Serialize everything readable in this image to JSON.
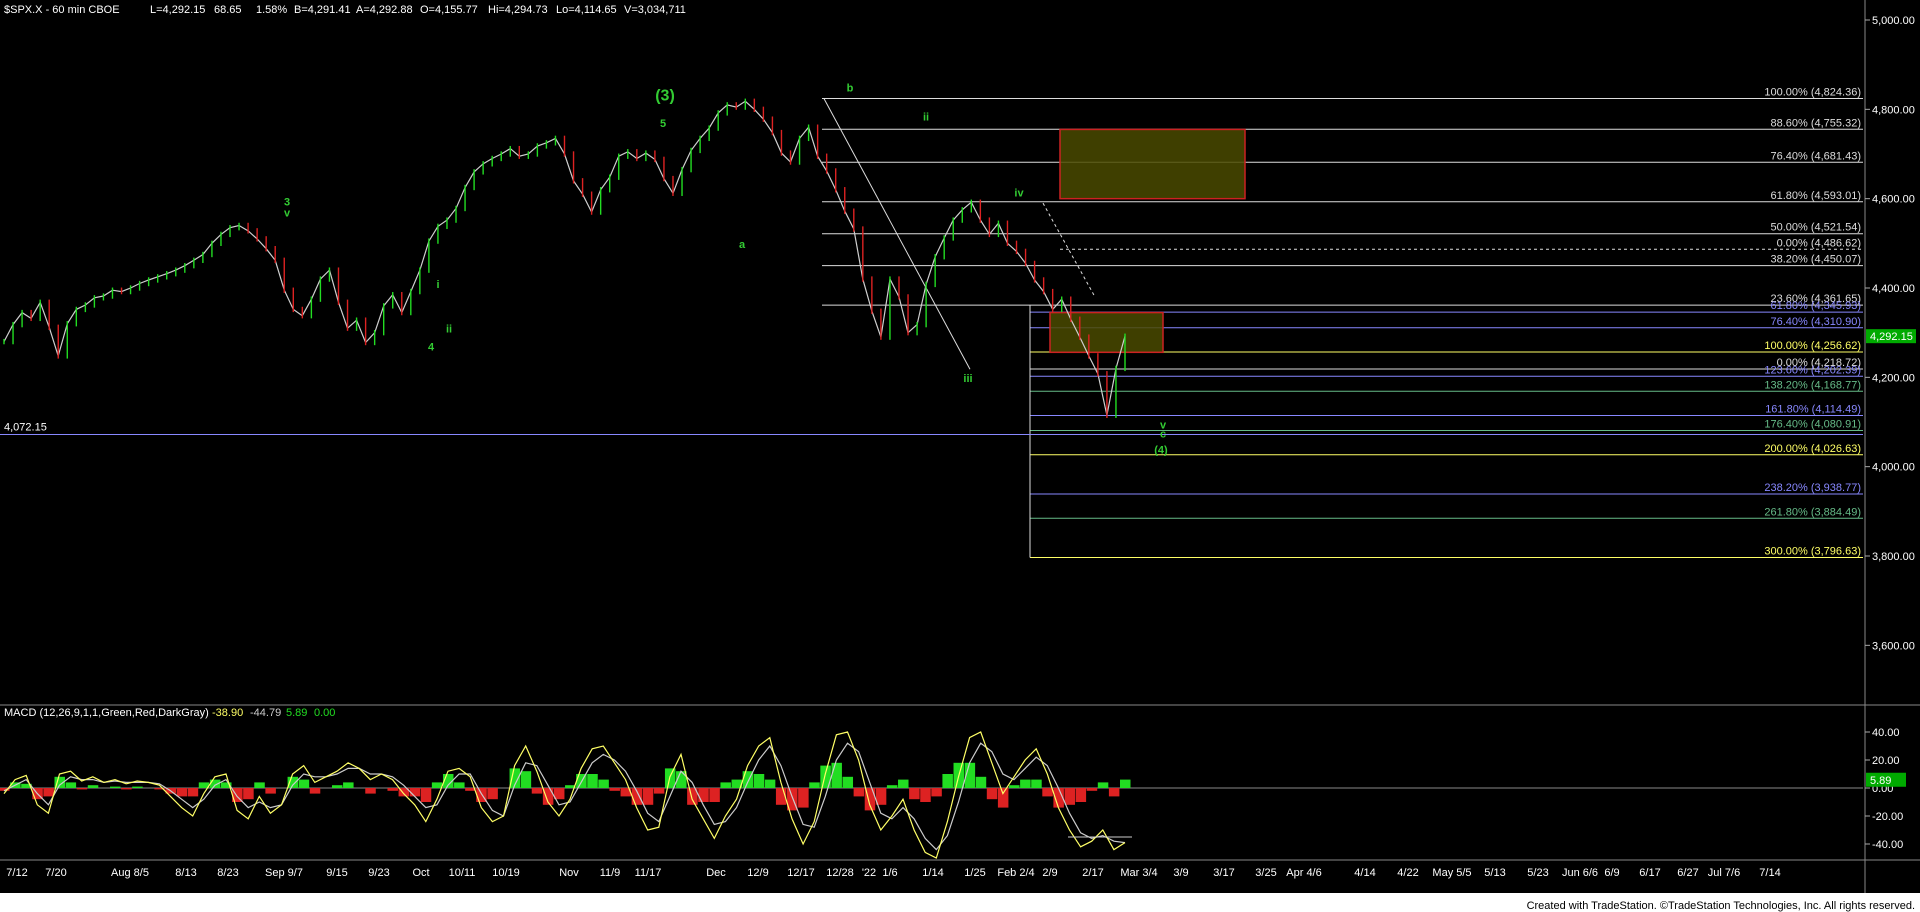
{
  "header": {
    "symbol": "$SPX.X - 60 min  CBOE",
    "last": "L=4,292.15",
    "change": "68.65",
    "change_pct": "1.58%",
    "bid": "B=4,291.41",
    "ask": "A=4,292.88",
    "open": "O=4,155.77",
    "high": "Hi=4,294.73",
    "low": "Lo=4,114.65",
    "volume": "V=3,034,711"
  },
  "footer": {
    "credit": "Created with TradeStation. ©TradeStation Technologies, Inc. All rights reserved."
  },
  "colors": {
    "background": "#000000",
    "up": "#22dd22",
    "down": "#dd2222",
    "wave_label": "#33cc33",
    "fib_yellow": "#ffff66",
    "fib_blue": "#8888ff",
    "fib_green": "#66bb88",
    "fib_white": "#dddddd",
    "macd_line": "#ffff66",
    "signal_line": "#cccccc",
    "last_price_tag": "#00aa00"
  },
  "chart_data": [
    {
      "type": "line",
      "title": "$SPX.X - 60 min",
      "ylim": [
        3500,
        5000
      ],
      "y_ticks": [
        "5,000.00",
        "4,800.00",
        "4,600.00",
        "4,400.00",
        "4,200.00",
        "4,000.00",
        "3,800.00",
        "3,600.00"
      ],
      "y_tick_values": [
        5000,
        4800,
        4600,
        4400,
        4200,
        4000,
        3800,
        3600
      ],
      "last_price_label": "4,292.15",
      "last_price": 4292.15,
      "x_ticks": [
        "7/12",
        "7/20",
        "Aug 8/5",
        "8/13",
        "8/23",
        "Sep 9/7",
        "9/15",
        "9/23",
        "Oct",
        "10/11",
        "10/19",
        "Nov",
        "11/9",
        "11/17",
        "Dec",
        "12/9",
        "12/17",
        "12/28",
        "'22",
        "1/6",
        "1/14",
        "1/25",
        "Feb 2/4",
        "2/9",
        "2/17",
        "Mar 3/4",
        "3/9",
        "3/17",
        "3/25",
        "Apr 4/6",
        "4/14",
        "4/22",
        "May 5/5",
        "5/13",
        "5/23",
        "Jun 6/6",
        "6/9",
        "6/17",
        "6/27",
        "Jul 7/6",
        "7/14"
      ],
      "series": [
        {
          "values": [
            4280,
            4318,
            4345,
            4332,
            4368,
            4312,
            4248,
            4320,
            4352,
            4362,
            4378,
            4382,
            4395,
            4392,
            4400,
            4410,
            4418,
            4425,
            4432,
            4440,
            4450,
            4462,
            4475,
            4500,
            4520,
            4535,
            4540,
            4528,
            4510,
            4488,
            4462,
            4395,
            4352,
            4338,
            4375,
            4420,
            4440,
            4368,
            4310,
            4328,
            4278,
            4300,
            4360,
            4385,
            4345,
            4392,
            4440,
            4505,
            4538,
            4552,
            4578,
            4625,
            4660,
            4678,
            4690,
            4700,
            4712,
            4695,
            4700,
            4718,
            4725,
            4735,
            4700,
            4640,
            4610,
            4570,
            4620,
            4648,
            4695,
            4705,
            4690,
            4702,
            4688,
            4645,
            4612,
            4665,
            4708,
            4735,
            4758,
            4792,
            4810,
            4805,
            4818,
            4800,
            4778,
            4748,
            4702,
            4682,
            4735,
            4760,
            4695,
            4662,
            4620,
            4572,
            4532,
            4420,
            4348,
            4290,
            4420,
            4380,
            4300,
            4318,
            4408,
            4470,
            4512,
            4552,
            4575,
            4592,
            4552,
            4520,
            4545,
            4500,
            4482,
            4455,
            4418,
            4392,
            4352,
            4375,
            4330,
            4290,
            4248,
            4208,
            4115,
            4220,
            4292
          ]
        }
      ]
    },
    {
      "type": "line",
      "title": "MACD (12,26,9,1,1,Green,Red,DarkGray)",
      "values_text": [
        "-38.90",
        "-44.79",
        "5.89",
        "0.00"
      ],
      "ylim": [
        -50,
        50
      ],
      "y_ticks": [
        "40.00",
        "20.00",
        "0.00",
        "-20.00",
        "-40.00"
      ],
      "y_tick_values": [
        40,
        20,
        0,
        -20,
        -40
      ],
      "last_value_label": "5.89",
      "last_value": 5.89,
      "series": [
        {
          "name": "MACD",
          "values": [
            -4,
            6,
            9,
            -12,
            -18,
            10,
            12,
            5,
            8,
            4,
            6,
            3,
            5,
            4,
            2,
            -6,
            -14,
            -20,
            -4,
            8,
            10,
            -16,
            -22,
            -6,
            -18,
            -12,
            10,
            16,
            4,
            8,
            12,
            18,
            14,
            6,
            10,
            6,
            -4,
            -12,
            -24,
            -8,
            12,
            14,
            8,
            -14,
            -24,
            -20,
            16,
            30,
            12,
            -10,
            -20,
            -8,
            14,
            28,
            30,
            18,
            6,
            -14,
            -30,
            -28,
            8,
            24,
            -8,
            -22,
            -36,
            -20,
            -8,
            16,
            30,
            36,
            4,
            -22,
            -40,
            -24,
            10,
            38,
            40,
            20,
            -12,
            -30,
            -20,
            -8,
            -30,
            -46,
            -50,
            -24,
            8,
            36,
            40,
            18,
            -4,
            8,
            20,
            28,
            10,
            -14,
            -30,
            -42,
            -38,
            -30,
            -44,
            -39
          ]
        },
        {
          "name": "Signal",
          "values": [
            -2,
            2,
            6,
            -4,
            -12,
            2,
            8,
            6,
            6,
            4,
            5,
            4,
            4,
            4,
            3,
            -2,
            -8,
            -14,
            -8,
            2,
            6,
            -6,
            -14,
            -10,
            -14,
            -12,
            2,
            10,
            8,
            8,
            10,
            14,
            14,
            10,
            10,
            8,
            2,
            -6,
            -14,
            -12,
            2,
            10,
            10,
            -4,
            -16,
            -20,
            2,
            18,
            16,
            2,
            -12,
            -10,
            4,
            18,
            24,
            20,
            12,
            -2,
            -18,
            -24,
            -6,
            12,
            4,
            -12,
            -26,
            -24,
            -14,
            4,
            20,
            30,
            16,
            -6,
            -26,
            -28,
            -6,
            20,
            32,
            26,
            4,
            -18,
            -22,
            -14,
            -22,
            -36,
            -44,
            -34,
            -10,
            18,
            32,
            26,
            10,
            6,
            14,
            22,
            16,
            0,
            -18,
            -32,
            -36,
            -34,
            -38,
            -39
          ]
        },
        {
          "name": "Histogram",
          "values": [
            -2,
            4,
            3,
            -8,
            -6,
            8,
            4,
            -1,
            2,
            0,
            1,
            -1,
            1,
            0,
            -1,
            -4,
            -6,
            -6,
            4,
            6,
            4,
            -10,
            -8,
            4,
            -4,
            0,
            8,
            6,
            -4,
            0,
            2,
            4,
            0,
            -4,
            0,
            -2,
            -6,
            -6,
            -10,
            4,
            10,
            4,
            -2,
            -10,
            -8,
            0,
            14,
            12,
            -4,
            -12,
            -8,
            2,
            10,
            10,
            6,
            -2,
            -6,
            -12,
            -12,
            -4,
            14,
            12,
            -12,
            -10,
            -10,
            4,
            6,
            12,
            10,
            6,
            -12,
            -16,
            -14,
            4,
            16,
            18,
            8,
            -6,
            -16,
            -12,
            2,
            6,
            -8,
            -10,
            -6,
            10,
            18,
            18,
            8,
            -8,
            -14,
            2,
            6,
            6,
            -6,
            -14,
            -12,
            -10,
            -2,
            4,
            -6,
            6
          ]
        }
      ]
    }
  ],
  "annotations": {
    "wave_labels": [
      {
        "text": "(3)",
        "price": 4820
      },
      {
        "text": "5",
        "price": 4760
      },
      {
        "text": "3",
        "price": 4585
      },
      {
        "text": "v",
        "price": 4560
      },
      {
        "text": "a",
        "price": 4490
      },
      {
        "text": "b",
        "price": 4840
      },
      {
        "text": "ii",
        "price": 4775
      },
      {
        "text": "iv",
        "price": 4605
      },
      {
        "text": "i",
        "price": 4400
      },
      {
        "text": "ii",
        "price": 4300
      },
      {
        "text": "4",
        "price": 4260
      },
      {
        "text": "iii",
        "price": 4190
      },
      {
        "text": "v",
        "price": 4085
      },
      {
        "text": "c",
        "price": 4065
      },
      {
        "text": "(4)",
        "price": 4030
      }
    ],
    "support_line_label": "4,072.15",
    "support_line_price": 4072.15,
    "fib_levels": [
      {
        "label": "100.00% (4,824.36)",
        "price": 4824.36,
        "color": "white"
      },
      {
        "label": "88.60% (4,755.32)",
        "price": 4755.32,
        "color": "white"
      },
      {
        "label": "76.40% (4,681.43)",
        "price": 4681.43,
        "color": "white"
      },
      {
        "label": "61.80% (4,593.01)",
        "price": 4593.01,
        "color": "white"
      },
      {
        "label": "50.00% (4,521.54)",
        "price": 4521.54,
        "color": "white"
      },
      {
        "label": "0.00% (4,486.62)",
        "price": 4486.62,
        "color": "white"
      },
      {
        "label": "38.20% (4,450.07)",
        "price": 4450.07,
        "color": "white"
      },
      {
        "label": "23.60% (4,361.65)",
        "price": 4361.65,
        "color": "white"
      },
      {
        "label": "61.80% (4,345.93)",
        "price": 4345.93,
        "color": "blue"
      },
      {
        "label": "76.40% (4,310.90)",
        "price": 4310.9,
        "color": "blue"
      },
      {
        "label": "100.00% (4,256.62)",
        "price": 4256.62,
        "color": "yellow"
      },
      {
        "label": "0.00% (4,218.72)",
        "price": 4218.72,
        "color": "white"
      },
      {
        "label": "123.60% (4,202.39)",
        "price": 4202.39,
        "color": "blue"
      },
      {
        "label": "138.20% (4,168.77)",
        "price": 4168.77,
        "color": "green"
      },
      {
        "label": "161.80% (4,114.49)",
        "price": 4114.49,
        "color": "blue"
      },
      {
        "label": "176.40% (4,080.91)",
        "price": 4080.91,
        "color": "green"
      },
      {
        "label": "200.00% (4,026.63)",
        "price": 4026.63,
        "color": "yellow"
      },
      {
        "label": "238.20% (3,938.77)",
        "price": 3938.77,
        "color": "blue"
      },
      {
        "label": "261.80% (3,884.49)",
        "price": 3884.49,
        "color": "green"
      },
      {
        "label": "300.00% (3,796.63)",
        "price": 3796.63,
        "color": "yellow"
      }
    ],
    "boxes": [
      {
        "name": "upper-target-box",
        "price_top": 4755,
        "price_bottom": 4600
      },
      {
        "name": "lower-target-box",
        "price_top": 4345,
        "price_bottom": 4256
      }
    ]
  }
}
